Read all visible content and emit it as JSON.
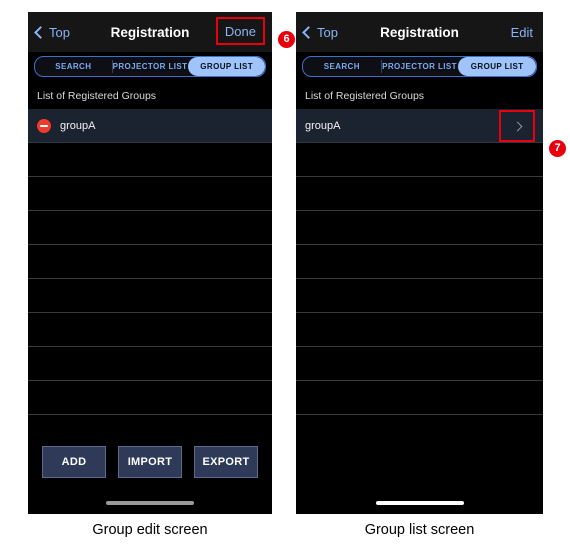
{
  "panels": {
    "left": {
      "nav": {
        "back_label": "Top",
        "title": "Registration",
        "action_label": "Done"
      },
      "segmented": {
        "options": [
          "SEARCH",
          "PROJECTOR LIST",
          "GROUP LIST"
        ],
        "selected": "GROUP LIST"
      },
      "list": {
        "header": "List of Registered Groups",
        "rows": [
          {
            "label": "groupA",
            "has_delete": true
          }
        ],
        "empty_row_count": 10
      },
      "buttons": [
        "ADD",
        "IMPORT",
        "EXPORT"
      ],
      "caption": "Group edit screen"
    },
    "right": {
      "nav": {
        "back_label": "Top",
        "title": "Registration",
        "action_label": "Edit"
      },
      "segmented": {
        "options": [
          "SEARCH",
          "PROJECTOR LIST",
          "GROUP LIST"
        ],
        "selected": "GROUP LIST"
      },
      "list": {
        "header": "List of Registered Groups",
        "rows": [
          {
            "label": "groupA",
            "has_chevron": true
          }
        ],
        "empty_row_count": 10
      },
      "caption": "Group list screen"
    }
  },
  "callouts": [
    {
      "number": "6",
      "target": "done-button"
    },
    {
      "number": "7",
      "target": "group-row-chevron"
    }
  ],
  "colors": {
    "accent_blue": "#8ab4f8",
    "segment_active": "#9ec4fb",
    "callout_red": "#e8000d",
    "delete_red": "#ef3b2d",
    "button_fill": "#2e3a57",
    "row_fill": "#1b2230"
  }
}
